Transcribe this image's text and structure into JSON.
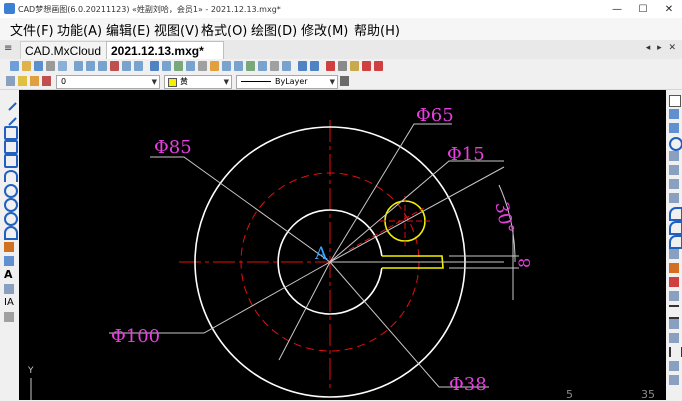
{
  "window": {
    "title": "CAD梦想画图(6.0.20211123) «姓副刘哈，会员1» - 2021.12.13.mxg*",
    "controls": [
      "—",
      "☐",
      "✕"
    ]
  },
  "menu": [
    "文件(F)",
    "功能(A)",
    "编辑(E)",
    "视图(V)",
    "格式(O)",
    "绘图(D)",
    "修改(M)",
    "帮助(H)"
  ],
  "tabs": [
    {
      "label": "CAD.MxCloud",
      "active": false
    },
    {
      "label": "2021.12.13.mxg*",
      "active": true
    }
  ],
  "tab_controls": "◂ ▸ ✕",
  "properties_bar": {
    "layer": "0",
    "color": "黄",
    "linetype": "ByLayer"
  },
  "drawing": {
    "dimensions": [
      "Φ65",
      "Φ85",
      "Φ15",
      "30°",
      "8",
      "Φ100",
      "Φ38"
    ],
    "center_letter": "A",
    "status_numbers": [
      "5",
      "35"
    ],
    "ucs_label": "Y",
    "colors": {
      "background": "#000000",
      "outline": "#ffffff",
      "center_lines": "#e01010",
      "dimension_text": "#e83fe0",
      "dimension_lines": "#c8c8c8",
      "keyway": "#f4f000",
      "center_letter": "#3aa5ff"
    }
  }
}
